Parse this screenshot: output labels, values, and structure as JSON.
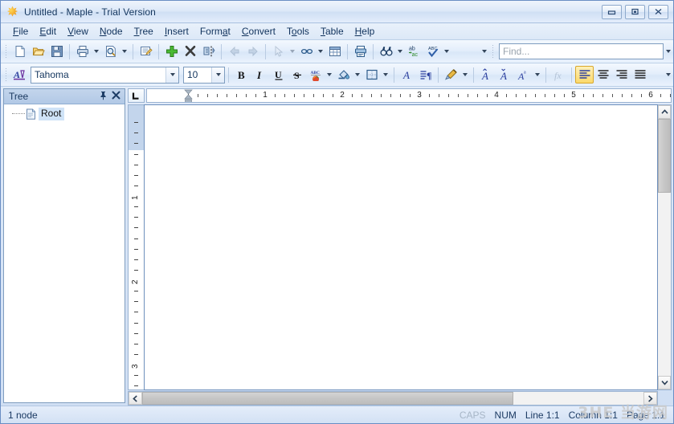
{
  "window": {
    "title": "Untitled - Maple - Trial Version",
    "app_icon": "maple-leaf-icon",
    "controls": {
      "minimize": "minimize-button",
      "maximize": "maximize-button",
      "close": "close-button"
    }
  },
  "menubar": {
    "items": [
      {
        "label": "File",
        "mnemonic": "F"
      },
      {
        "label": "Edit",
        "mnemonic": "E"
      },
      {
        "label": "View",
        "mnemonic": "V"
      },
      {
        "label": "Node",
        "mnemonic": "N"
      },
      {
        "label": "Tree",
        "mnemonic": "T"
      },
      {
        "label": "Insert",
        "mnemonic": "I"
      },
      {
        "label": "Format",
        "mnemonic": "a"
      },
      {
        "label": "Convert",
        "mnemonic": "C"
      },
      {
        "label": "Tools",
        "mnemonic": "o"
      },
      {
        "label": "Table",
        "mnemonic": "T"
      },
      {
        "label": "Help",
        "mnemonic": "H"
      }
    ]
  },
  "toolbar_standard": {
    "buttons": [
      {
        "name": "new-document-button",
        "icon": "new-page-icon",
        "enabled": true
      },
      {
        "name": "open-button",
        "icon": "open-folder-icon",
        "enabled": true
      },
      {
        "name": "save-button",
        "icon": "floppy-disk-icon",
        "enabled": true
      },
      {
        "name": "print-button",
        "icon": "printer-icon",
        "enabled": true,
        "dropdown": true
      },
      {
        "name": "print-preview-button",
        "icon": "magnifier-page-icon",
        "enabled": true,
        "dropdown": true
      },
      {
        "name": "node-properties-button",
        "icon": "note-edit-icon",
        "enabled": true
      },
      {
        "name": "add-node-button",
        "icon": "green-plus-icon",
        "enabled": true
      },
      {
        "name": "delete-node-button",
        "icon": "black-x-icon",
        "enabled": true
      },
      {
        "name": "split-node-button",
        "icon": "split-node-icon",
        "enabled": true
      },
      {
        "name": "back-button",
        "icon": "left-arrow-icon",
        "enabled": false
      },
      {
        "name": "forward-button",
        "icon": "right-arrow-icon",
        "enabled": false
      },
      {
        "name": "select-pointer-button",
        "icon": "cursor-arrow-icon",
        "enabled": false,
        "dropdown": true
      },
      {
        "name": "hyperlink-button",
        "icon": "chain-link-icon",
        "enabled": true,
        "dropdown": true
      },
      {
        "name": "insert-table-button",
        "icon": "grid-table-icon",
        "enabled": true
      },
      {
        "name": "print-node-button",
        "icon": "print-node-icon",
        "enabled": true
      },
      {
        "name": "find-button",
        "icon": "binoculars-icon",
        "enabled": true,
        "dropdown": true
      },
      {
        "name": "replace-button",
        "icon": "ab-to-ac-icon",
        "enabled": true
      },
      {
        "name": "spell-check-button",
        "icon": "abc-check-icon",
        "enabled": true,
        "dropdown": true
      }
    ],
    "overflow_icon": "toolbar-overflow-icon",
    "find": {
      "placeholder": "Find...",
      "value": "",
      "dropdown_icon": "chevron-down-icon"
    }
  },
  "toolbar_format": {
    "style_button": {
      "name": "styles-button",
      "icon": "blue-a-underline-icon"
    },
    "font": {
      "value": "Tahoma",
      "dropdown_icon": "chevron-down-icon"
    },
    "size": {
      "value": "10",
      "dropdown_icon": "chevron-down-icon"
    },
    "buttons": [
      {
        "name": "bold-button",
        "label": "B",
        "icon": "bold-icon"
      },
      {
        "name": "italic-button",
        "label": "I",
        "icon": "italic-icon"
      },
      {
        "name": "underline-button",
        "label": "U",
        "icon": "underline-icon"
      },
      {
        "name": "strikethrough-button",
        "label": "S",
        "icon": "strikethrough-icon"
      },
      {
        "name": "font-color-button",
        "icon": "abc-color-icon",
        "dropdown": true
      },
      {
        "name": "highlight-color-button",
        "icon": "paint-bucket-icon",
        "dropdown": true
      },
      {
        "name": "borders-button",
        "icon": "border-grid-icon",
        "dropdown": true
      },
      {
        "name": "font-dialog-button",
        "icon": "italic-a-icon"
      },
      {
        "name": "paragraph-marks-button",
        "icon": "pilcrow-lines-icon"
      },
      {
        "name": "format-painter-button",
        "icon": "paint-brush-icon",
        "dropdown": true
      },
      {
        "name": "increase-font-button",
        "icon": "a-up-icon"
      },
      {
        "name": "decrease-font-button",
        "icon": "a-down-icon"
      },
      {
        "name": "change-case-button",
        "icon": "a-case-icon",
        "dropdown": true
      },
      {
        "name": "function-button",
        "icon": "fx-icon"
      },
      {
        "name": "align-left-button",
        "icon": "align-left-icon",
        "active": true
      },
      {
        "name": "align-center-button",
        "icon": "align-center-icon"
      },
      {
        "name": "align-right-button",
        "icon": "align-right-icon"
      },
      {
        "name": "align-justify-button",
        "icon": "align-justify-icon"
      }
    ],
    "overflow_icon": "toolbar-overflow-icon"
  },
  "tree_panel": {
    "title": "Tree",
    "pin_icon": "pin-icon",
    "close_icon": "close-x-icon",
    "nodes": [
      {
        "label": "Root",
        "icon": "document-page-icon",
        "selected": true
      }
    ]
  },
  "document": {
    "tab_selector_icon": "tab-stop-left-icon",
    "h_ruler": {
      "unit_marks": [
        "1",
        "2",
        "3",
        "4",
        "5",
        "6"
      ],
      "indent_marker_icon": "indent-marker-icon"
    },
    "v_ruler": {
      "unit_marks": [
        "1",
        "2",
        "3"
      ]
    },
    "content": "",
    "v_scrollbar": {
      "up_icon": "chevron-up-icon",
      "down_icon": "chevron-down-icon"
    },
    "h_scrollbar": {
      "left_icon": "chevron-left-icon",
      "right_icon": "chevron-right-icon"
    }
  },
  "statusbar": {
    "node_count": "1 node",
    "caps": "CAPS",
    "num": "NUM",
    "line": "Line 1:1",
    "column": "Column 1:1",
    "page": "Page 1:1",
    "watermark": "3HE 当游网"
  }
}
